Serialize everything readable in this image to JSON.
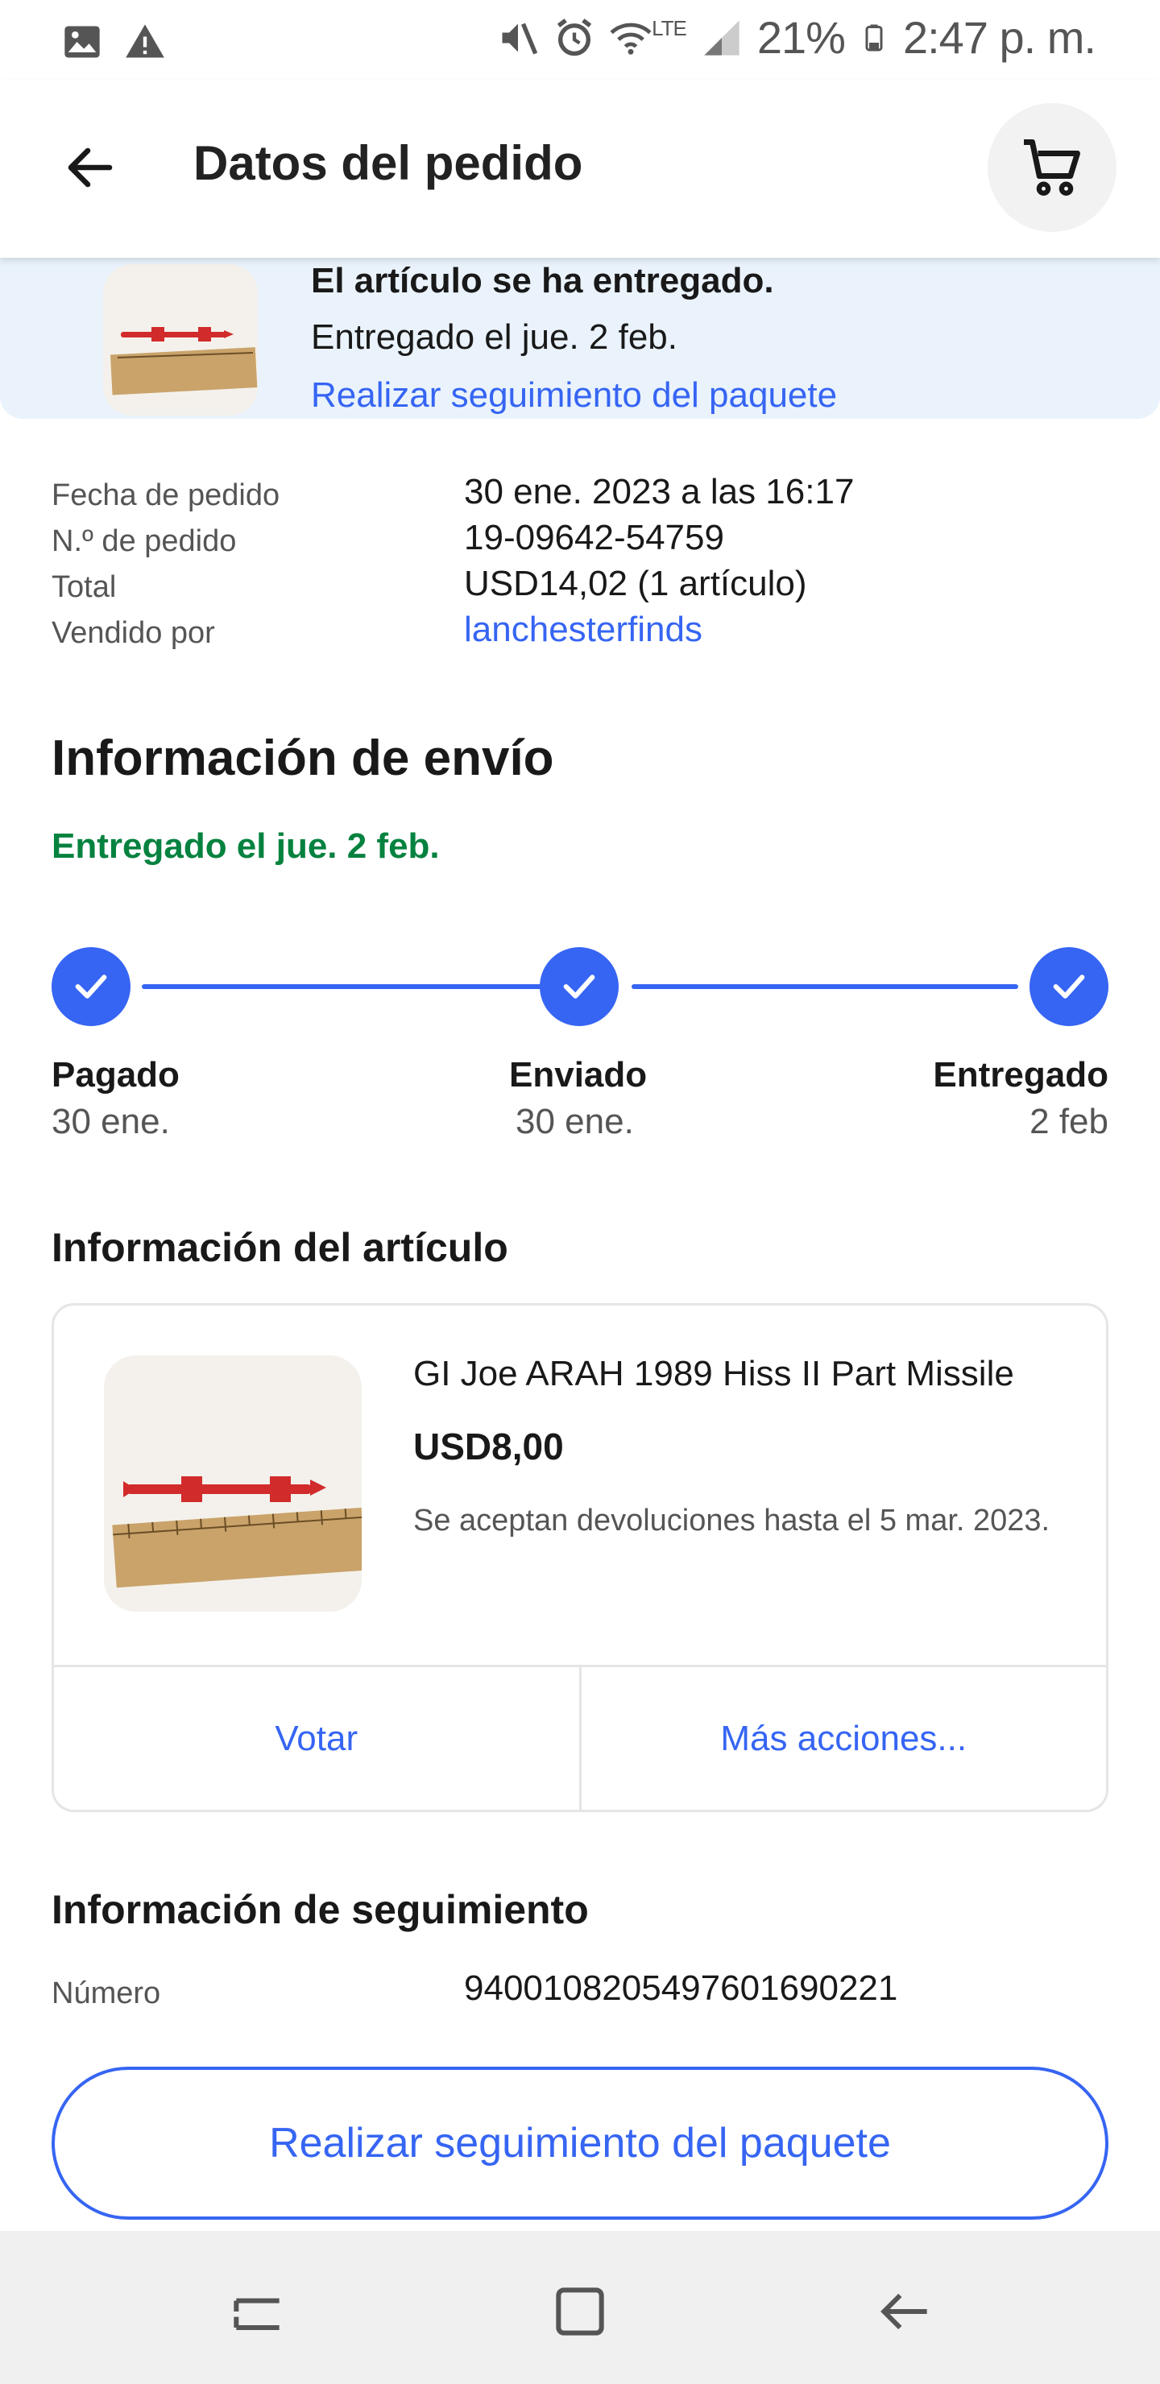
{
  "status_bar": {
    "battery": "21%",
    "time": "2:47 p. m.",
    "network": "LTE"
  },
  "header": {
    "title": "Datos del pedido"
  },
  "banner": {
    "title": "El artículo se ha entregado.",
    "subtitle": "Entregado el jue. 2 feb.",
    "link": "Realizar seguimiento del paquete"
  },
  "order_details": {
    "rows": [
      {
        "label": "Fecha de pedido",
        "value": "30 ene. 2023 a las 16:17"
      },
      {
        "label": "N.º de pedido",
        "value": "19-09642-54759"
      },
      {
        "label": "Total",
        "value": "USD14,02 (1 artículo)"
      },
      {
        "label": "Vendido por",
        "value": "lanchesterfinds"
      }
    ]
  },
  "shipping": {
    "heading": "Información de envío",
    "status": "Entregado el jue. 2 feb.",
    "steps": [
      {
        "label": "Pagado",
        "date": "30 ene."
      },
      {
        "label": "Enviado",
        "date": "30 ene."
      },
      {
        "label": "Entregado",
        "date": "2 feb"
      }
    ]
  },
  "item": {
    "heading": "Información del artículo",
    "title": "GI Joe ARAH 1989 Hiss II Part Missile",
    "price": "USD8,00",
    "returns": "Se aceptan devoluciones hasta el 5 mar. 2023.",
    "actions": [
      "Votar",
      "Más acciones..."
    ]
  },
  "tracking": {
    "heading": "Información de seguimiento",
    "number_label": "Número",
    "number": "9400108205497601690221",
    "button": "Realizar seguimiento del paquete"
  },
  "colors": {
    "accent": "#3665f3",
    "success": "#05823f",
    "banner_bg": "#eaf3fc"
  }
}
